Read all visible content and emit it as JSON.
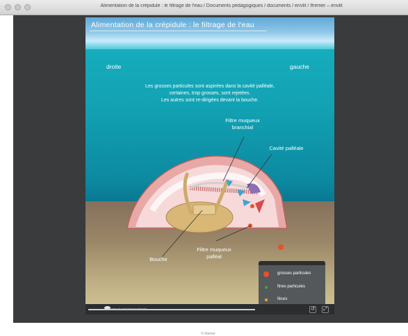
{
  "window": {
    "title": "Alimentation de la crépidule : le filtrage de l'eau / Documents pédagogiques / documents / envlit / Ifremer – envlit"
  },
  "animation": {
    "title": "Alimentation de la crépidule : le filtrage de l'eau",
    "side_right": "droite",
    "side_left": "gauche",
    "description_lines": [
      "Les grosses particules sont aspirées dans la cavité palléale,",
      "certaines, trop grosses, sont rejetées.",
      "Les autres sont re-dirigées devant la bouche."
    ],
    "labels": {
      "branchial_line1": "Filtre muqueux",
      "branchial_line2": "branchial",
      "cavity": "Cavité palléale",
      "palleal_line1": "Filtre muqueux",
      "palleal_line2": "palléal",
      "mouth": "Bouche"
    }
  },
  "legend": {
    "items": [
      {
        "label": "grosses particules",
        "color": "#e8502a"
      },
      {
        "label": "fines particules",
        "color": "#3faa3a"
      },
      {
        "label": "fèces",
        "color": "#e6b21e"
      }
    ]
  },
  "player": {
    "credit": "©Ifremer/ environnement",
    "progress": 1.0,
    "replay_icon": "replay-icon",
    "fullscreen_icon": "fullscreen-icon"
  },
  "footer": {
    "text": "© Ifremer"
  }
}
